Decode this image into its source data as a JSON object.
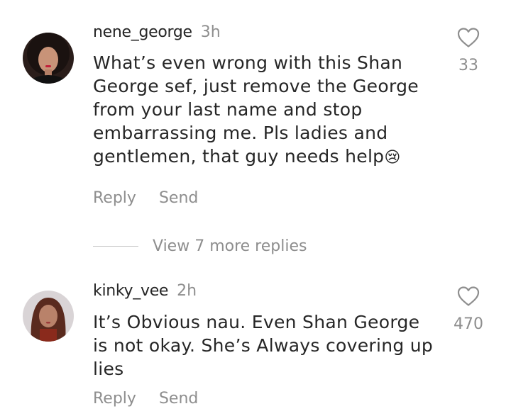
{
  "comments": [
    {
      "username": "nene_george",
      "time": "3h",
      "text_lines": [
        "What’s even wrong with this Shan",
        "George sef, just remove the George",
        "from your last name and stop",
        "embarrassing me. Pls ladies and",
        "gentlemen, that guy needs help"
      ],
      "emoji": "😢",
      "likes": "33",
      "reply_label": "Reply",
      "send_label": "Send",
      "icons": {
        "avatar": "avatar",
        "like": "heart-outline-icon",
        "emoji": "crying-face-emoji"
      }
    },
    {
      "username": "kinky_vee",
      "time": "2h",
      "text_lines": [
        "It’s Obvious nau. Even Shan George",
        "is not okay. She’s Always covering up",
        "lies"
      ],
      "likes": "470",
      "reply_label": "Reply",
      "send_label": "Send",
      "icons": {
        "avatar": "avatar",
        "like": "heart-outline-icon"
      }
    }
  ],
  "view_replies_label": "View 7 more replies",
  "colors": {
    "text": "#262626",
    "secondary": "#8e8e8e",
    "divider": "#c7c7c7"
  }
}
